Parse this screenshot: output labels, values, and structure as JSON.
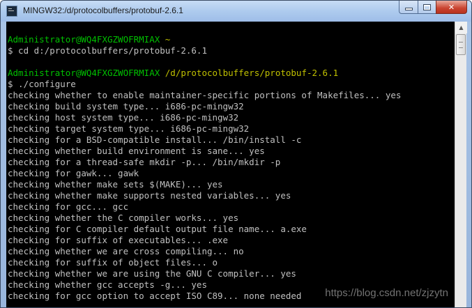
{
  "window": {
    "title": "MINGW32:/d/protocolbuffers/protobuf-2.6.1",
    "icon": "terminal-icon",
    "minimize_glyph": "minimize-icon",
    "maximize_glyph": "maximize-icon",
    "close_glyph": "✕"
  },
  "terminal": {
    "blocks": [
      {
        "user": "Administrator@WQ4FXGZWOFRMIAX",
        "path": "~",
        "command": "$ cd d:/protocolbuffers/protobuf-2.6.1"
      },
      {
        "user": "Administrator@WQ4FXGZWOFRMIAX",
        "path": "/d/protocolbuffers/protobuf-2.6.1",
        "command": "$ ./configure"
      }
    ],
    "output": [
      "checking whether to enable maintainer-specific portions of Makefiles... yes",
      "checking build system type... i686-pc-mingw32",
      "checking host system type... i686-pc-mingw32",
      "checking target system type... i686-pc-mingw32",
      "checking for a BSD-compatible install... /bin/install -c",
      "checking whether build environment is sane... yes",
      "checking for a thread-safe mkdir -p... /bin/mkdir -p",
      "checking for gawk... gawk",
      "checking whether make sets $(MAKE)... yes",
      "checking whether make supports nested variables... yes",
      "checking for gcc... gcc",
      "checking whether the C compiler works... yes",
      "checking for C compiler default output file name... a.exe",
      "checking for suffix of executables... .exe",
      "checking whether we are cross compiling... no",
      "checking for suffix of object files... o",
      "checking whether we are using the GNU C compiler... yes",
      "checking whether gcc accepts -g... yes",
      "checking for gcc option to accept ISO C89... none needed"
    ]
  },
  "watermark": "https://blog.csdn.net/zjzytn",
  "colors": {
    "user": "#00c000",
    "path": "#c0c000",
    "text": "#c0c0c0",
    "background": "#000000"
  }
}
